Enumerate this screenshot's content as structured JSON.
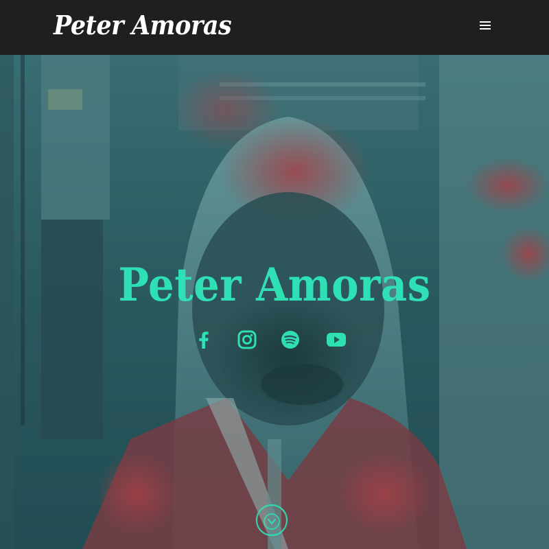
{
  "header": {
    "logo_text": "Peter Amoras",
    "menu_icon": "hamburger-menu-icon"
  },
  "hero": {
    "title": "Peter Amoras",
    "accent_color": "#2fe0b4",
    "socials": [
      {
        "name": "facebook",
        "icon": "facebook-icon"
      },
      {
        "name": "instagram",
        "icon": "instagram-icon"
      },
      {
        "name": "spotify",
        "icon": "spotify-icon"
      },
      {
        "name": "youtube",
        "icon": "youtube-icon"
      }
    ],
    "scroll_icon": "chevron-down-circle-icon"
  },
  "colors": {
    "header_bg": "#1f1f1f",
    "logo": "#ffffff",
    "accent": "#2fe0b4",
    "hero_tint": "#2c5f63"
  }
}
